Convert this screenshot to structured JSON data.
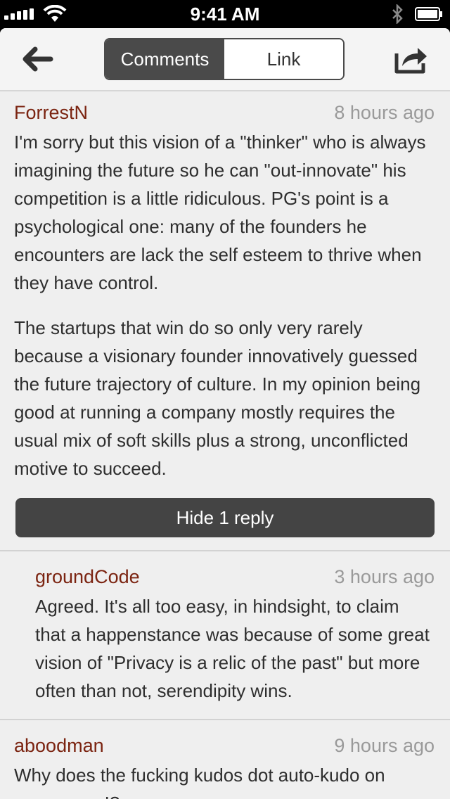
{
  "status_bar": {
    "time": "9:41 AM"
  },
  "nav": {
    "tabs": [
      {
        "label": "Comments",
        "active": true
      },
      {
        "label": "Link",
        "active": false
      }
    ],
    "back_icon": "back-arrow-icon",
    "share_icon": "share-icon"
  },
  "comments": [
    {
      "author": "ForrestN",
      "time": "8 hours ago",
      "paragraphs": [
        "I'm sorry but this vision of a \"thinker\" who is always imagining the future so he can \"out-innovate\" his competition is a little ridiculous. PG's point is a psychological one: many of the founders he encounters are lack the self esteem to thrive when they have control.",
        "The startups that win do so only very rarely because a visionary founder innovatively guessed the future trajectory of culture. In my opinion being good at running a company mostly requires the usual mix of soft skills plus a strong, unconflicted motive to succeed."
      ],
      "reply_button": "Hide 1 reply"
    },
    {
      "author": "groundCode",
      "time": "3 hours ago",
      "paragraphs": [
        "Agreed. It's all too easy, in hindsight, to claim that a happenstance was because of some great vision of \"Privacy is a relic of the past\" but more often than not, serendipity wins."
      ]
    },
    {
      "author": "aboodman",
      "time": "9 hours ago",
      "paragraphs": [
        "Why does the fucking kudos dot auto-kudo on mouseover!?"
      ]
    }
  ],
  "colors": {
    "author": "#7b2411",
    "time": "#9a9a9a",
    "segment_active": "#4a4a4a",
    "button": "#444444",
    "background": "#efefef"
  }
}
